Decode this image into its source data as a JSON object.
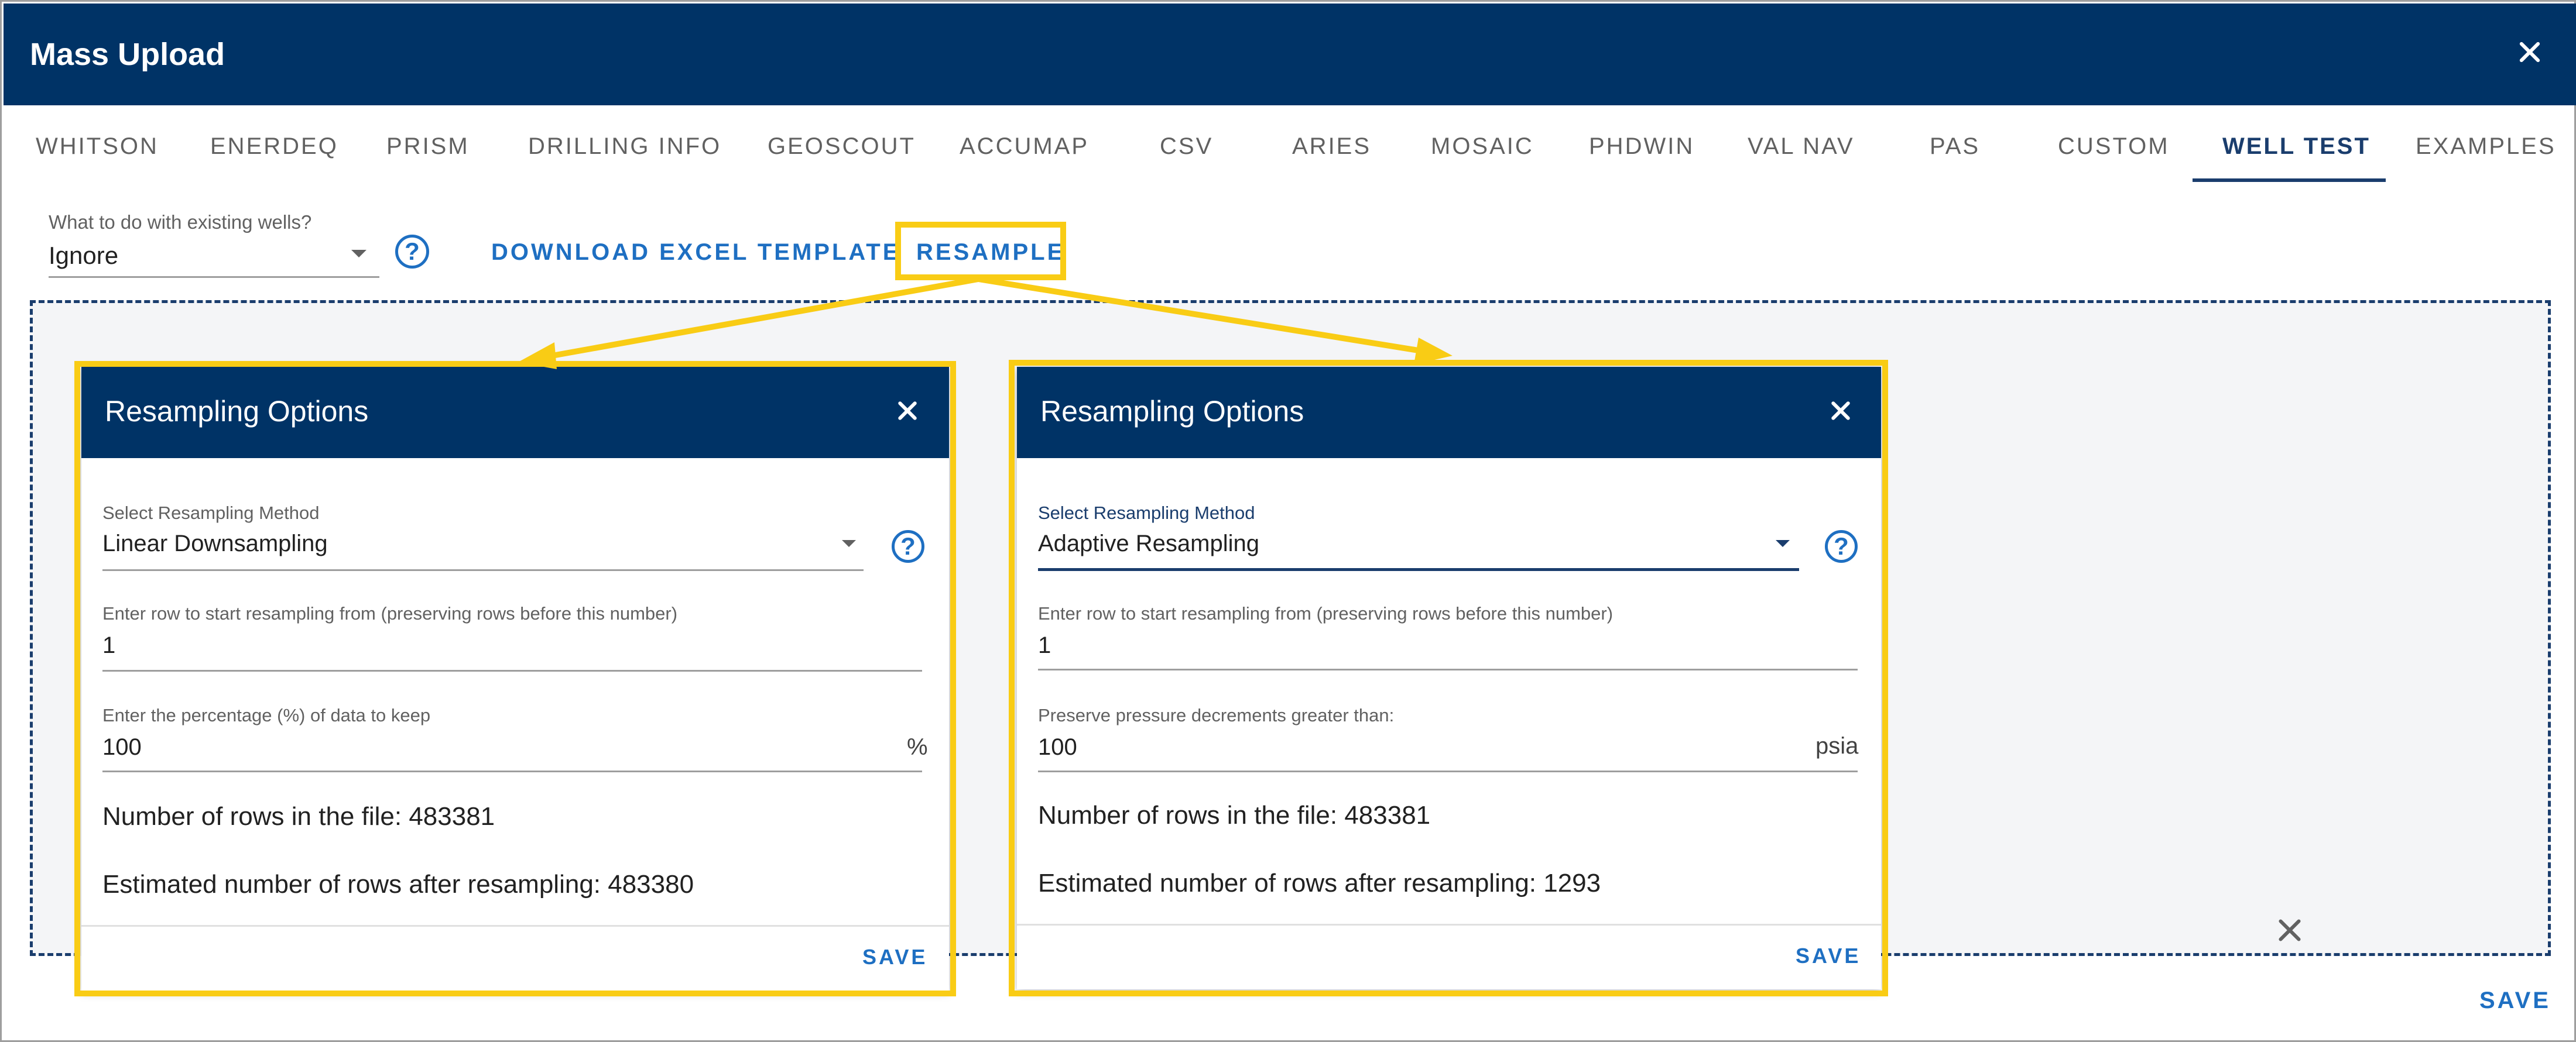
{
  "window": {
    "title": "Mass Upload"
  },
  "tabs": [
    {
      "label": "WHITSON"
    },
    {
      "label": "ENERDEQ"
    },
    {
      "label": "PRISM"
    },
    {
      "label": "DRILLING INFO"
    },
    {
      "label": "GEOSCOUT"
    },
    {
      "label": "ACCUMAP"
    },
    {
      "label": "CSV"
    },
    {
      "label": "ARIES"
    },
    {
      "label": "MOSAIC"
    },
    {
      "label": "PHDWIN"
    },
    {
      "label": "VAL NAV"
    },
    {
      "label": "PAS"
    },
    {
      "label": "CUSTOM"
    },
    {
      "label": "WELL TEST"
    },
    {
      "label": "EXAMPLES"
    }
  ],
  "active_tab": "WELL TEST",
  "toolbar": {
    "existing_label": "What to do with existing wells?",
    "existing_value": "Ignore",
    "help_glyph": "?",
    "download_label": "DOWNLOAD EXCEL TEMPLATE",
    "resample_label": "RESAMPLE"
  },
  "dialogs": [
    {
      "title": "Resampling Options",
      "method_label": "Select Resampling Method",
      "method_value": "Linear Downsampling",
      "start_row_label": "Enter row to start resampling from (preserving rows before this number)",
      "start_row_value": "1",
      "param_label": "Enter the percentage (%) of data to keep",
      "param_value": "100",
      "param_unit": "%",
      "rows_in_file": "Number of rows in the file: 483381",
      "rows_after": "Estimated number of rows after resampling: 483380",
      "save_label": "SAVE"
    },
    {
      "title": "Resampling Options",
      "method_label": "Select Resampling Method",
      "method_value": "Adaptive Resampling",
      "start_row_label": "Enter row to start resampling from (preserving rows before this number)",
      "start_row_value": "1",
      "param_label": "Preserve pressure decrements greater than:",
      "param_value": "100",
      "param_unit": "psia",
      "rows_in_file": "Number of rows in the file: 483381",
      "rows_after": "Estimated number of rows after resampling: 1293",
      "save_label": "SAVE"
    }
  ],
  "footer": {
    "save_label": "SAVE"
  },
  "colors": {
    "header": "#003366",
    "accent": "#1e6fc2",
    "highlight": "#f9cc15",
    "dropzone_bg": "#f4f5f7"
  },
  "icons": [
    "close-icon",
    "dropdown-caret-icon",
    "help-icon"
  ]
}
